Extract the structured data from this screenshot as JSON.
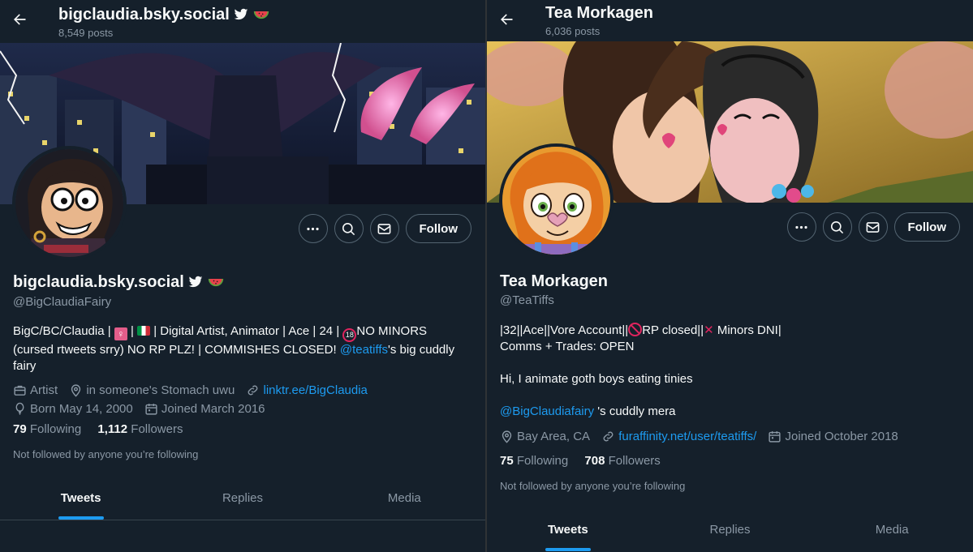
{
  "left": {
    "header": {
      "title": "bigclaudia.bsky.social",
      "posts": "8,549 posts"
    },
    "profile": {
      "name": "bigclaudia.bsky.social",
      "handle": "@BigClaudiaFairy",
      "bio_p1": "BigC/BC/Claudia | ",
      "bio_p2": " | ",
      "bio_p3": " | Digital Artist, Animator | Ace | 24 | ",
      "bio_p4": "NO MINORS (cursed rtweets srry) NO RP PLZ! | COMMISHES CLOSED! ",
      "bio_mention": "@teatiffs",
      "bio_p5": "'s big cuddly fairy",
      "occupation": "Artist",
      "location": "in someone's Stomach uwu",
      "website": "linktr.ee/BigClaudia",
      "born": "Born May 14, 2000",
      "joined": "Joined March 2016",
      "following_count": "79",
      "following_label": "Following",
      "followers_count": "1,112",
      "followers_label": "Followers",
      "not_followed": "Not followed by anyone you’re following"
    },
    "actions": {
      "follow": "Follow"
    },
    "tabs": [
      "Tweets",
      "Replies",
      "Media"
    ]
  },
  "right": {
    "header": {
      "title": "Tea Morkagen",
      "posts": "6,036 posts"
    },
    "profile": {
      "name": "Tea Morkagen",
      "handle": "@TeaTiffs",
      "bio_l1a": "|32||Ace||Vore Account||",
      "bio_l1b": "RP closed||",
      "bio_l1c": " Minors DNI|",
      "bio_l2": "Comms + Trades: OPEN",
      "bio_l3": "Hi, I animate goth boys eating tinies",
      "bio_mention": "@BigClaudiafairy",
      "bio_l4": " 's  cuddly mera",
      "location": "Bay Area, CA",
      "website": "furaffinity.net/user/teatiffs/",
      "joined": "Joined October 2018",
      "following_count": "75",
      "following_label": "Following",
      "followers_count": "708",
      "followers_label": "Followers",
      "not_followed": "Not followed by anyone you’re following"
    },
    "actions": {
      "follow": "Follow"
    },
    "tabs": [
      "Tweets",
      "Replies",
      "Media"
    ]
  },
  "colors": {
    "background": "#15202b",
    "accent": "#1d9bf0",
    "muted": "#8b98a5",
    "border": "#536471"
  }
}
